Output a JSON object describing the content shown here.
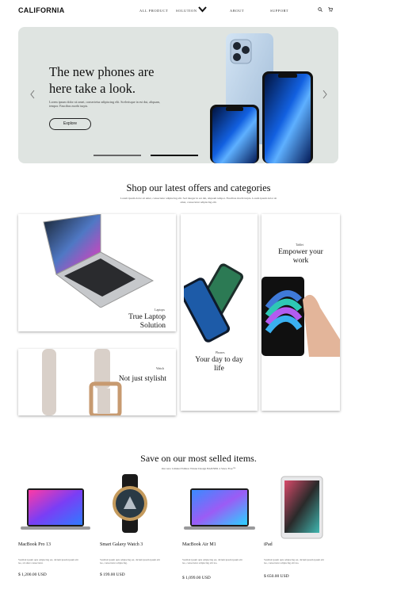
{
  "nav": {
    "logo": "CALIFORNIA",
    "items": [
      "ALL PRODUCT",
      "SOLUTION",
      "ABOUT",
      "SUPPORT"
    ]
  },
  "hero": {
    "title": "The new phones are here take a look.",
    "subtitle": "Lorem ipsum dolor sit amet, consectetur adipiscing elit. Scelerisque in est dui, aliquam, tempor. Faucibus morbi turpis.",
    "button": "Explore"
  },
  "categories": {
    "title": "Shop our latest offers and categories",
    "subtitle": "Lorem ipsum dolor sit amet, consectetur adipiscing elit. Sed integer in est dui, aliquam tempor. Faucibus morbi turpis. Lorem ipsum dolor sit amet, consectetur adipiscing elit.",
    "laptop": {
      "tag": "Laptops",
      "title": "True Laptop Solution"
    },
    "phones": {
      "tag": "Phones",
      "title": "Your day to day life"
    },
    "tablet": {
      "tag": "Tablet",
      "title": "Empower your work"
    },
    "watch": {
      "tag": "Watch",
      "title": "Not just stylisht"
    }
  },
  "bestsellers": {
    "title": "Save on our most selled items.",
    "subtitle": "Our new Limited Edition Winter Design BANNER 4 Since Free™",
    "products": [
      {
        "name": "MacBook Pro 13",
        "desc": "Vestibul ipsum quis adipiscing est, dictum ipsum ipsum elit leo, sit amet consectetur.",
        "price": "$ 1,200.00 USD"
      },
      {
        "name": "Smart Galaxy Watch 3",
        "desc": "Vestibul ipsum quis adipiscing est, dictum ipsum ipsum elit leo, consectetur adipiscing.",
        "price": "$ 199.00 USD"
      },
      {
        "name": "MacBook Air M1",
        "desc": "Vestibul ipsum quis adipiscing est, dictum ipsum ipsum elit leo, consectetur adipiscing elit leo.",
        "price": "$ 1,099.00 USD"
      },
      {
        "name": "iPad",
        "desc": "Vestibul ipsum quis adipiscing est, dictum ipsum ipsum elit leo, consectetur adipiscing elit leo.",
        "price": "$ 650.00 USD"
      }
    ]
  },
  "colors": {
    "hero_bg": "#dfe4e1",
    "text": "#111111"
  },
  "icons": [
    "search-icon",
    "cart-icon",
    "chevron-down-icon",
    "arrow-left-icon",
    "arrow-right-icon"
  ]
}
